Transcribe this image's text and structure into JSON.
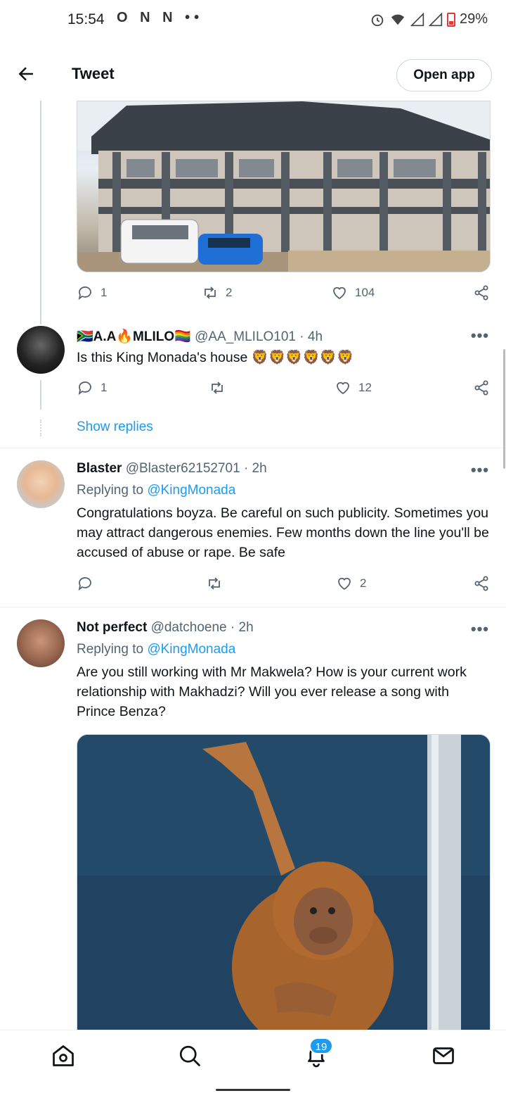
{
  "status_bar": {
    "time": "15:54",
    "left_icons": "O N N ••",
    "battery": "29%",
    "right_icons": [
      "alarm-icon",
      "wifi-icon",
      "signal-icon",
      "signal-icon",
      "battery-low-icon"
    ]
  },
  "header": {
    "title": "Tweet",
    "open_app": "Open app",
    "back_icon": "arrow-left-icon"
  },
  "tweets": [
    {
      "id": "house",
      "media_alt": "house",
      "reply_count": "1",
      "retweet_count": "2",
      "like_count": "104"
    },
    {
      "id": "aa",
      "name": "🇿🇦A.A🔥MLILO🏳️‍🌈",
      "handle": "@AA_MLILO101",
      "time": "· 4h",
      "text": "Is this King Monada's house 🦁🦁🦁🦁🦁🦁",
      "reply_count": "1",
      "retweet_count": "",
      "like_count": "12",
      "show_replies": "Show replies"
    },
    {
      "id": "blaster",
      "name": "Blaster",
      "handle": "@Blaster62152701",
      "time": "· 2h",
      "replying_prefix": "Replying to",
      "replying_to": "@KingMonada",
      "text": "Congratulations boyza. Be careful on such publicity. Sometimes you may attract dangerous enemies. Few months down the line you'll be accused of abuse or rape. Be safe",
      "reply_count": "",
      "retweet_count": "",
      "like_count": "2"
    },
    {
      "id": "notperfect",
      "name": "Not perfect",
      "handle": "@datchoene",
      "time": "· 2h",
      "replying_prefix": "Replying to",
      "replying_to": "@KingMonada",
      "text": "Are you still working with Mr Makwela? How is your current work relationship with Makhadzi? Will you ever release a song with Prince Benza?"
    }
  ],
  "bottom_nav": {
    "items": [
      "home-icon",
      "search-icon",
      "notifications-icon",
      "messages-icon"
    ],
    "notifications_badge": "19"
  },
  "colors": {
    "accent": "#1d9bf0",
    "text": "#0f1419",
    "secondary": "#536471",
    "divider": "#eff3f4"
  }
}
